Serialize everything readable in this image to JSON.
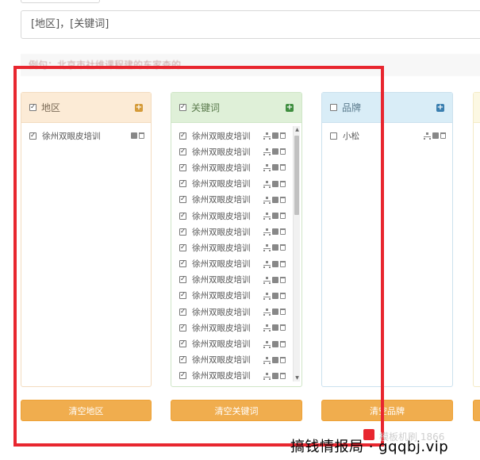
{
  "formula_input": {
    "value": "[地区]，[关键词]"
  },
  "hint": "例句：北京市社维课程建的东家查的",
  "panels": {
    "region": {
      "title": "地区",
      "header_checked": true,
      "items": [
        {
          "label": "徐州双眼皮培训",
          "checked": true
        }
      ],
      "clear_label": "清空地区"
    },
    "keyword": {
      "title": "关键词",
      "header_checked": true,
      "items": [
        {
          "label": "徐州双眼皮培训",
          "checked": true
        },
        {
          "label": "徐州双眼皮培训",
          "checked": true
        },
        {
          "label": "徐州双眼皮培训",
          "checked": true
        },
        {
          "label": "徐州双眼皮培训",
          "checked": true
        },
        {
          "label": "徐州双眼皮培训",
          "checked": true
        },
        {
          "label": "徐州双眼皮培训",
          "checked": true
        },
        {
          "label": "徐州双眼皮培训",
          "checked": true
        },
        {
          "label": "徐州双眼皮培训",
          "checked": true
        },
        {
          "label": "徐州双眼皮培训",
          "checked": true
        },
        {
          "label": "徐州双眼皮培训",
          "checked": true
        },
        {
          "label": "徐州双眼皮培训",
          "checked": true
        },
        {
          "label": "徐州双眼皮培训",
          "checked": true
        },
        {
          "label": "徐州双眼皮培训",
          "checked": true
        },
        {
          "label": "徐州双眼皮培训",
          "checked": true
        },
        {
          "label": "徐州双眼皮培训",
          "checked": true
        },
        {
          "label": "徐州双眼皮培训",
          "checked": true
        }
      ],
      "clear_label": "清空关键词"
    },
    "brand": {
      "title": "品牌",
      "header_checked": false,
      "items": [
        {
          "label": "小松",
          "checked": false
        }
      ],
      "clear_label": "清空品牌"
    }
  },
  "watermark": {
    "text": "搞钱情报局 · gqqbj.vip",
    "faint_text": "模板机刷 1866"
  },
  "colors": {
    "region_header": "#fcebd6",
    "keyword_header": "#dff0d8",
    "brand_header": "#d9edf7",
    "clear_button": "#f0ad4e",
    "highlight_box": "#e8262f"
  }
}
